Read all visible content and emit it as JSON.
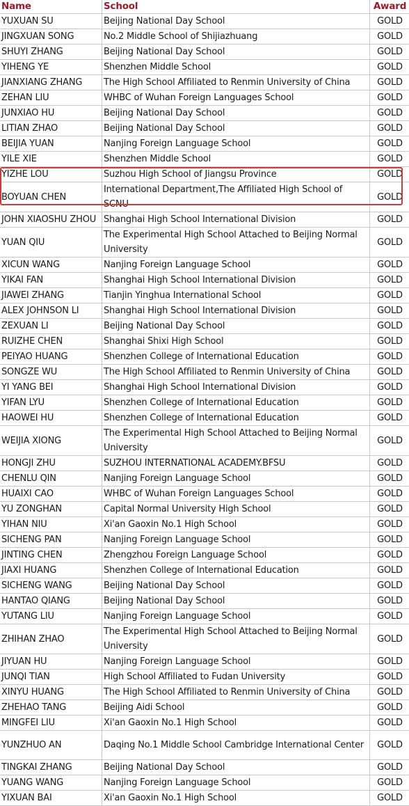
{
  "headers": {
    "name": "Name",
    "school": "School",
    "award": "Award"
  },
  "colors": {
    "header_text": "#9a1c2a",
    "highlight_border": "#d23a3a",
    "grid": "#c8c8c8"
  },
  "highlighted_row_index": 11,
  "rows": [
    {
      "name": "YUXUAN SU",
      "school": "Beijing National Day School",
      "award": "GOLD"
    },
    {
      "name": "JINGXUAN SONG",
      "school": "No.2 Middle School of Shijiazhuang",
      "award": "GOLD"
    },
    {
      "name": "SHUYI ZHANG",
      "school": "Beijing National Day School",
      "award": "GOLD"
    },
    {
      "name": "YIHENG YE",
      "school": "Shenzhen Middle School",
      "award": "GOLD"
    },
    {
      "name": "JIANXIANG ZHANG",
      "school": "The High School Affiliated to Renmin University of China",
      "award": "GOLD"
    },
    {
      "name": "ZEHAN LIU",
      "school": "WHBC of Wuhan Foreign Languages School",
      "award": "GOLD"
    },
    {
      "name": "JUNXIAO HU",
      "school": "Beijing National Day School",
      "award": "GOLD"
    },
    {
      "name": "LITIAN ZHAO",
      "school": "Beijing National Day School",
      "award": "GOLD"
    },
    {
      "name": "BEIJIA YUAN",
      "school": "Nanjing Foreign Language School",
      "award": "GOLD"
    },
    {
      "name": "YILE XIE",
      "school": "Shenzhen Middle School",
      "award": "GOLD"
    },
    {
      "name": "YIZHE LOU",
      "school": "Suzhou High School of Jiangsu Province",
      "award": "GOLD"
    },
    {
      "name": "BOYUAN CHEN",
      "school": "International Department,The Affiliated High School of SCNU",
      "award": "GOLD",
      "tall": true
    },
    {
      "name": "JOHN XIAOSHU ZHOU",
      "school": "Shanghai High School International Division",
      "award": "GOLD"
    },
    {
      "name": "YUAN QIU",
      "school": "The Experimental High School Attached to Beijing Normal University",
      "award": "GOLD",
      "tall": true
    },
    {
      "name": "XICUN WANG",
      "school": "Nanjing Foreign Language School",
      "award": "GOLD"
    },
    {
      "name": "YIKAI FAN",
      "school": "Shanghai High School International Division",
      "award": "GOLD"
    },
    {
      "name": "JIAWEI ZHANG",
      "school": "Tianjin Yinghua International School",
      "award": "GOLD"
    },
    {
      "name": "ALEX JOHNSON LI",
      "school": "Shanghai High School International Division",
      "award": "GOLD"
    },
    {
      "name": "ZEXUAN LI",
      "school": "Beijing National Day School",
      "award": "GOLD"
    },
    {
      "name": "RUIZHE CHEN",
      "school": "Shanghai Shixi High School",
      "award": "GOLD"
    },
    {
      "name": "PEIYAO HUANG",
      "school": "Shenzhen College of International Education",
      "award": "GOLD"
    },
    {
      "name": "SONGZE WU",
      "school": "The High School Affiliated to Renmin University of China",
      "award": "GOLD"
    },
    {
      "name": "YI YANG BEI",
      "school": "Shanghai High School International Division",
      "award": "GOLD"
    },
    {
      "name": "YIFAN LYU",
      "school": "Shenzhen College of International Education",
      "award": "GOLD"
    },
    {
      "name": "HAOWEI HU",
      "school": "Shenzhen College of International Education",
      "award": "GOLD"
    },
    {
      "name": "WEIJIA XIONG",
      "school": "The Experimental High School Attached to Beijing Normal University",
      "award": "GOLD",
      "tall": true
    },
    {
      "name": "HONGJI ZHU",
      "school": "SUZHOU INTERNATIONAL ACADEMY.BFSU",
      "award": "GOLD"
    },
    {
      "name": "CHENLU QIN",
      "school": "Nanjing Foreign Language School",
      "award": "GOLD"
    },
    {
      "name": "HUAIXI CAO",
      "school": "WHBC of Wuhan Foreign Languages School",
      "award": "GOLD"
    },
    {
      "name": "YU ZONGHAN",
      "school": "Capital Normal University High School",
      "award": "GOLD"
    },
    {
      "name": "YIHAN NIU",
      "school": "Xi'an Gaoxin No.1 High School",
      "award": "GOLD"
    },
    {
      "name": "SICHENG PAN",
      "school": "Nanjing Foreign Language School",
      "award": "GOLD"
    },
    {
      "name": "JINTING CHEN",
      "school": "Zhengzhou Foreign Language School",
      "award": "GOLD"
    },
    {
      "name": "JIAXI HUANG",
      "school": "Shenzhen College of International Education",
      "award": "GOLD"
    },
    {
      "name": "SICHENG WANG",
      "school": " Beijing National Day School",
      "award": "GOLD"
    },
    {
      "name": "HANTAO QIANG",
      "school": "Beijing National Day School",
      "award": "GOLD"
    },
    {
      "name": "YUTANG LIU",
      "school": "Nanjing Foreign Language School",
      "award": "GOLD"
    },
    {
      "name": "ZHIHAN ZHAO",
      "school": "The Experimental High School Attached to Beijing Normal University",
      "award": "GOLD",
      "tall": true
    },
    {
      "name": "JIYUAN HU",
      "school": "Nanjing Foreign Language School",
      "award": "GOLD"
    },
    {
      "name": "JUNQI TIAN",
      "school": "High School Affiliated to Fudan University",
      "award": "GOLD"
    },
    {
      "name": "XINYU HUANG",
      "school": "The High School Affiliated to Renmin University of China",
      "award": "GOLD"
    },
    {
      "name": "ZHEHAO TANG",
      "school": "Beijing Aidi School",
      "award": "GOLD"
    },
    {
      "name": "MINGFEI LIU",
      "school": "Xi'an Gaoxin No.1 High School",
      "award": "GOLD"
    },
    {
      "name": "YUNZHUO AN",
      "school": "Daqing No.1 Middle School Cambridge International Center",
      "award": "GOLD",
      "tall": true
    },
    {
      "name": "TINGKAI ZHANG",
      "school": "Beijing National Day School",
      "award": "GOLD"
    },
    {
      "name": "YUANG WANG",
      "school": "Nanjing Foreign Language School",
      "award": "GOLD"
    },
    {
      "name": "YIXUAN BAI",
      "school": "Xi'an Gaoxin No.1 High School",
      "award": "GOLD"
    }
  ]
}
